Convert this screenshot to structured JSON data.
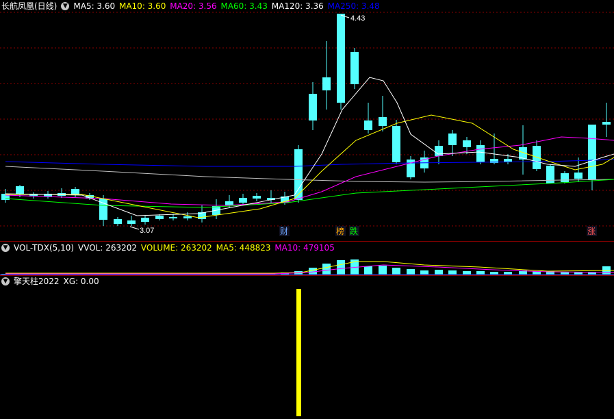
{
  "main_panel": {
    "title": "长航凤凰(日线)",
    "ma_labels": [
      {
        "text": "MA5: 3.60",
        "color": "#ffffff"
      },
      {
        "text": "MA10: 3.60",
        "color": "#ffff00"
      },
      {
        "text": "MA20: 3.56",
        "color": "#ff00ff"
      },
      {
        "text": "MA60: 3.43",
        "color": "#00ff00"
      },
      {
        "text": "MA120: 3.36",
        "color": "#ffffff"
      },
      {
        "text": "MA250: 3.48",
        "color": "#0000ff"
      }
    ],
    "high_label": "4.43",
    "low_label": "3.07",
    "markers": [
      {
        "text": "财",
        "color": "#6fa8ff"
      },
      {
        "text": "榜",
        "color": "#ffaa00"
      },
      {
        "text": "跌",
        "color": "#00ff00"
      },
      {
        "text": "涨",
        "color": "#ff5555"
      }
    ]
  },
  "volume_panel": {
    "title": "VOL-TDX(5,10)",
    "labels": [
      {
        "text": "VVOL: 263202",
        "color": "#ffffff"
      },
      {
        "text": "VOLUME: 263202",
        "color": "#ffff00"
      },
      {
        "text": "MA5: 448823",
        "color": "#ffff00"
      },
      {
        "text": "MA10: 479105",
        "color": "#ff00ff"
      }
    ]
  },
  "indicator_panel": {
    "title": "擎天柱2022",
    "xg_label": "XG: 0.00"
  },
  "colors": {
    "up": "#ff3232",
    "down": "#54ffff",
    "grid": "#8b0000",
    "signal": "#ffff00"
  }
}
